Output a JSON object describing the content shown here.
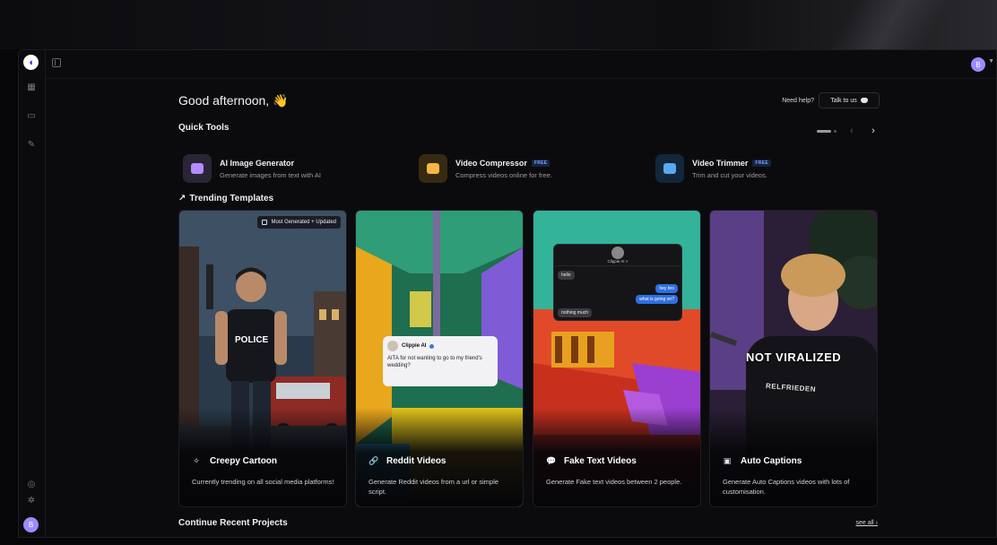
{
  "greeting": "Good afternoon,",
  "greeting_emoji": "👋",
  "help": {
    "label": "Need help?",
    "button": "Talk to us"
  },
  "quick_tools": {
    "title": "Quick Tools",
    "items": [
      {
        "name": "AI Image Generator",
        "badge": "",
        "desc": "Generate images from text with AI",
        "color": "#2a2536",
        "accent": "#b48cff"
      },
      {
        "name": "Video Compressor",
        "badge": "FREE",
        "desc": "Compress videos online for free.",
        "color": "#362a12",
        "accent": "#f5b844"
      },
      {
        "name": "Video Trimmer",
        "badge": "FREE",
        "desc": "Trim and cut your videos.",
        "color": "#12273a",
        "accent": "#5aa9f0"
      }
    ]
  },
  "trending": {
    "title": "Trending Templates",
    "cards": [
      {
        "title": "Creepy Cartoon",
        "desc": "Currently trending on all social media platforms!",
        "badge": "Most Generated + Updated",
        "icon": "✧"
      },
      {
        "title": "Reddit Videos",
        "desc": "Generate Reddit videos from a url or simple script.",
        "icon": "🔗"
      },
      {
        "title": "Fake Text Videos",
        "desc": "Generate Fake text videos between 2 people.",
        "icon": "💬"
      },
      {
        "title": "Auto Captions",
        "desc": "Generate Auto Captions videos with lots of customisation.",
        "icon": "▣"
      }
    ]
  },
  "reddit_post": {
    "name": "Clippie AI",
    "text": "AITA for not wanting to go to my friend's wedding?"
  },
  "chat": {
    "contact": "Clippie AI >",
    "messages": [
      "hello",
      "hey bro",
      "what is going on?",
      "nothing much"
    ]
  },
  "caption_overlay": "NOT VIRALIZED",
  "shirt_text": "RELFRIEDEN",
  "recent": {
    "title": "Continue Recent Projects",
    "see_all": "see all"
  },
  "user_initial": "B",
  "colors": {
    "badge_blue": "#7aa6ff",
    "avatar": "#9c8bff"
  }
}
